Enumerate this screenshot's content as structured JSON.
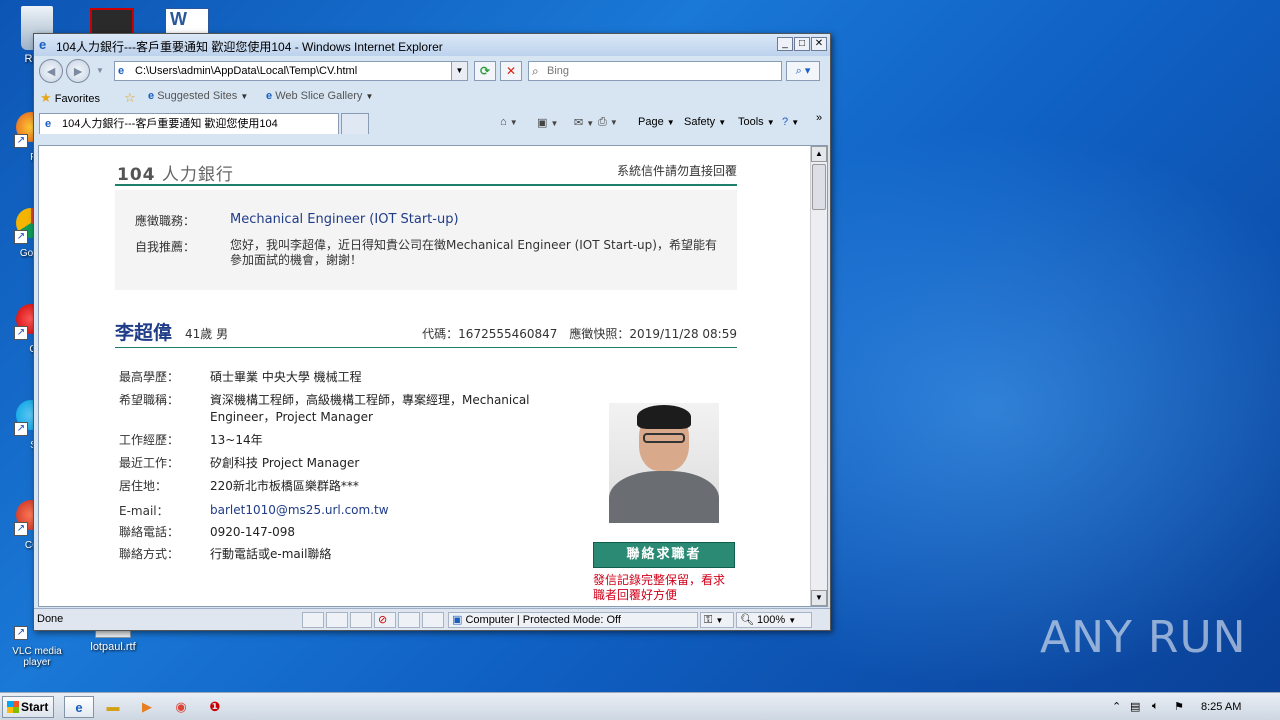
{
  "desktop": {
    "icons": [
      {
        "label": "Recy"
      },
      {
        "label": "Fir"
      },
      {
        "label": "Go Chr"
      },
      {
        "label": "Op"
      },
      {
        "label": "Sk"
      },
      {
        "label": "CCle"
      },
      {
        "label": "VLC media player"
      },
      {
        "label": "lotpaul.rtf"
      }
    ],
    "watermark": "ANY RUN"
  },
  "window": {
    "title": "104人力銀行---客戶重要通知 歡迎您使用104 - Windows Internet Explorer",
    "address": "C:\\Users\\admin\\AppData\\Local\\Temp\\CV.html",
    "search_placeholder": "Bing",
    "favorites_label": "Favorites",
    "suggested_sites": "Suggested Sites",
    "web_slice_gallery": "Web Slice Gallery",
    "tab_title": "104人力銀行---客戶重要通知 歡迎您使用104",
    "commands": {
      "page": "Page",
      "safety": "Safety",
      "tools": "Tools"
    },
    "status": {
      "text": "Done",
      "zone": "Computer | Protected Mode: Off",
      "zoom": "100%"
    }
  },
  "page": {
    "logo_num": "104",
    "logo_text": "人力銀行",
    "notice": "系統信件請勿直接回覆",
    "apply": {
      "job_label": "應徵職務：",
      "job_value": "Mechanical Engineer (IOT Start-up)",
      "self_label": "自我推薦：",
      "self_value": "您好，我叫李超偉，近日得知貴公司在徵Mechanical Engineer (IOT Start-up)，希望能有參加面試的機會，謝謝！"
    },
    "candidate": {
      "name": "李超偉",
      "age_gender": "41歲 男",
      "code_line": "代碼：1672555460847　應徵快照：2019/11/28 08:59"
    },
    "info": [
      {
        "k": "最高學歷：",
        "v": "碩士畢業 中央大學 機械工程"
      },
      {
        "k": "希望職稱：",
        "v": "資深機構工程師，高級機構工程師，專案經理，Mechanical Engineer，Project Manager"
      },
      {
        "k": "工作經歷：",
        "v": "13~14年"
      },
      {
        "k": "最近工作：",
        "v": "矽創科技 Project Manager"
      },
      {
        "k": "居住地：",
        "v": "220新北市板橋區樂群路***"
      },
      {
        "k": "E-mail：",
        "v": "barlet1010@ms25.url.com.tw"
      },
      {
        "k": "聯絡電話：",
        "v": "0920-147-098"
      },
      {
        "k": "聯絡方式：",
        "v": "行動電話或e-mail聯絡"
      }
    ],
    "contact_button": "聯絡求職者",
    "contact_note": "發信記錄完整保留，看求職者回覆好方便"
  },
  "taskbar": {
    "start": "Start",
    "clock": "8:25 AM"
  }
}
